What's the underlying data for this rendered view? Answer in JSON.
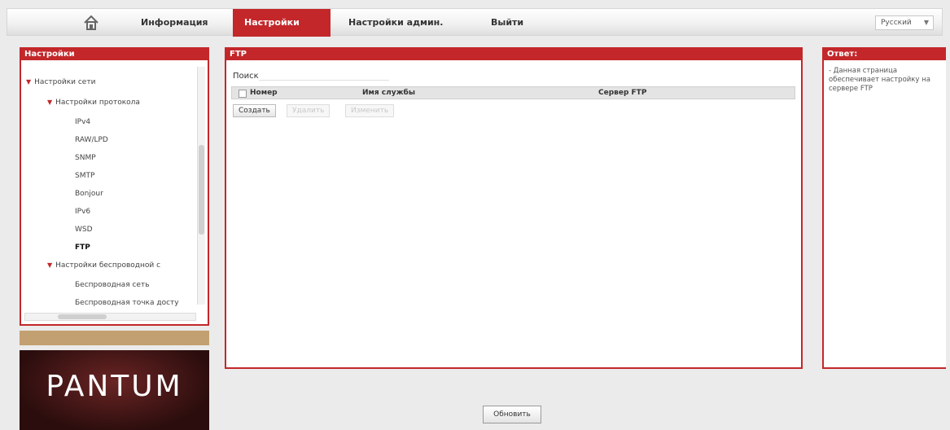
{
  "nav": {
    "home_icon": "home-icon",
    "items": [
      "Информация",
      "Настройки",
      "Настройки админ.",
      "Выйти"
    ],
    "active_index": 1,
    "language": "Русский"
  },
  "left_panel": {
    "title": "Настройки",
    "tree": [
      "Настройки сети",
      "Настройки протокола",
      "IPv4",
      "RAW/LPD",
      "SNMP",
      "SMTP",
      "Bonjour",
      "IPv6",
      "WSD",
      "FTP",
      "Настройки беспроводной с",
      "Беспроводная сеть",
      "Беспроводная точка досту"
    ]
  },
  "logo": {
    "text": "PANTUM"
  },
  "main": {
    "title": "FTP",
    "search_label": "Поиск",
    "columns": [
      "Номер",
      "Имя службы",
      "Сервер FTP"
    ],
    "buttons": {
      "create": "Создать",
      "delete": "Удалить",
      "edit": "Изменить"
    }
  },
  "help": {
    "title": "Ответ:",
    "text": "- Данная страница обеспечивает настройку на сервере FTP"
  },
  "footer": {
    "refresh_label": "Обновить"
  },
  "colors": {
    "accent": "#c3272a",
    "gold": "#c3a071"
  }
}
